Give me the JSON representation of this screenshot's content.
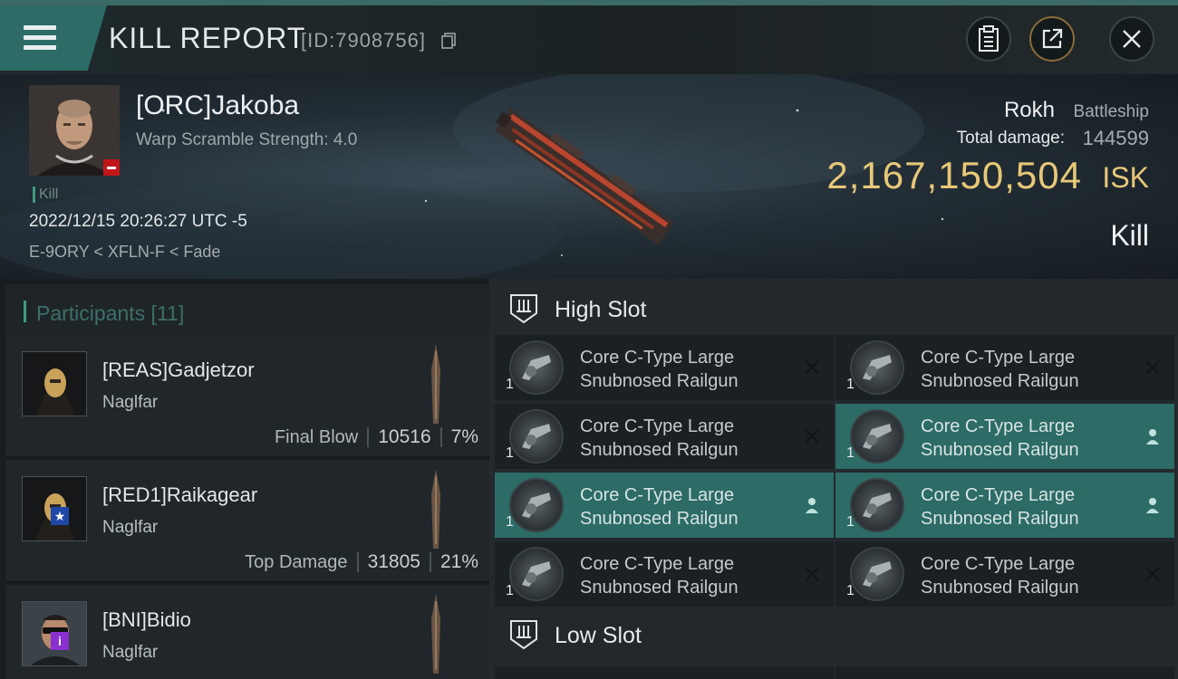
{
  "header": {
    "title": "KILL REPORT",
    "report_id": "[ID:7908756]"
  },
  "victim": {
    "name": "[ORC]Jakoba",
    "warp_scramble": "Warp Scramble Strength: 4.0",
    "kill_tag": "Kill",
    "datetime": "2022/12/15 20:26:27 UTC -5",
    "location": "E-9ORY < XFLN-F < Fade",
    "ship": "Rokh",
    "ship_class": "Battleship",
    "total_damage_label": "Total damage:",
    "total_damage": "144599",
    "isk_value": "2,167,150,504",
    "isk_unit": "ISK",
    "result": "Kill"
  },
  "participants": {
    "label": "Participants [11]",
    "rows": [
      {
        "name": "[REAS]Gadjetzor",
        "ship": "Naglfar",
        "stat_label": "Final Blow",
        "damage": "10516",
        "percent": "7%"
      },
      {
        "name": "[RED1]Raikagear",
        "ship": "Naglfar",
        "stat_label": "Top Damage",
        "damage": "31805",
        "percent": "21%"
      },
      {
        "name": "[BNI]Bidio",
        "ship": "Naglfar"
      }
    ]
  },
  "slots": {
    "high": {
      "title": "High Slot",
      "modules": [
        {
          "line1": "Core C-Type Large",
          "line2": "Snubnosed Railgun",
          "qty": "1",
          "status": "destroyed"
        },
        {
          "line1": "Core C-Type Large",
          "line2": "Snubnosed Railgun",
          "qty": "1",
          "status": "destroyed"
        },
        {
          "line1": "Core C-Type Large",
          "line2": "Snubnosed Railgun",
          "qty": "1",
          "status": "destroyed"
        },
        {
          "line1": "Core C-Type Large",
          "line2": "Snubnosed Railgun",
          "qty": "1",
          "status": "dropped"
        },
        {
          "line1": "Core C-Type Large",
          "line2": "Snubnosed Railgun",
          "qty": "1",
          "status": "dropped"
        },
        {
          "line1": "Core C-Type Large",
          "line2": "Snubnosed Railgun",
          "qty": "1",
          "status": "dropped"
        },
        {
          "line1": "Core C-Type Large",
          "line2": "Snubnosed Railgun",
          "qty": "1",
          "status": "destroyed"
        },
        {
          "line1": "Core C-Type Large",
          "line2": "Snubnosed Railgun",
          "qty": "1",
          "status": "destroyed"
        }
      ]
    },
    "low": {
      "title": "Low Slot"
    }
  },
  "colors": {
    "accent_teal": "#2c6b66",
    "isk_gold": "#e7c878",
    "kill_green": "#3e9b7b"
  },
  "icons": [
    "menu-icon",
    "copy-icon",
    "clipboard-icon",
    "share-icon",
    "close-icon",
    "slot-icon",
    "railgun-icon",
    "destroyed-x-icon",
    "dropped-person-icon"
  ]
}
